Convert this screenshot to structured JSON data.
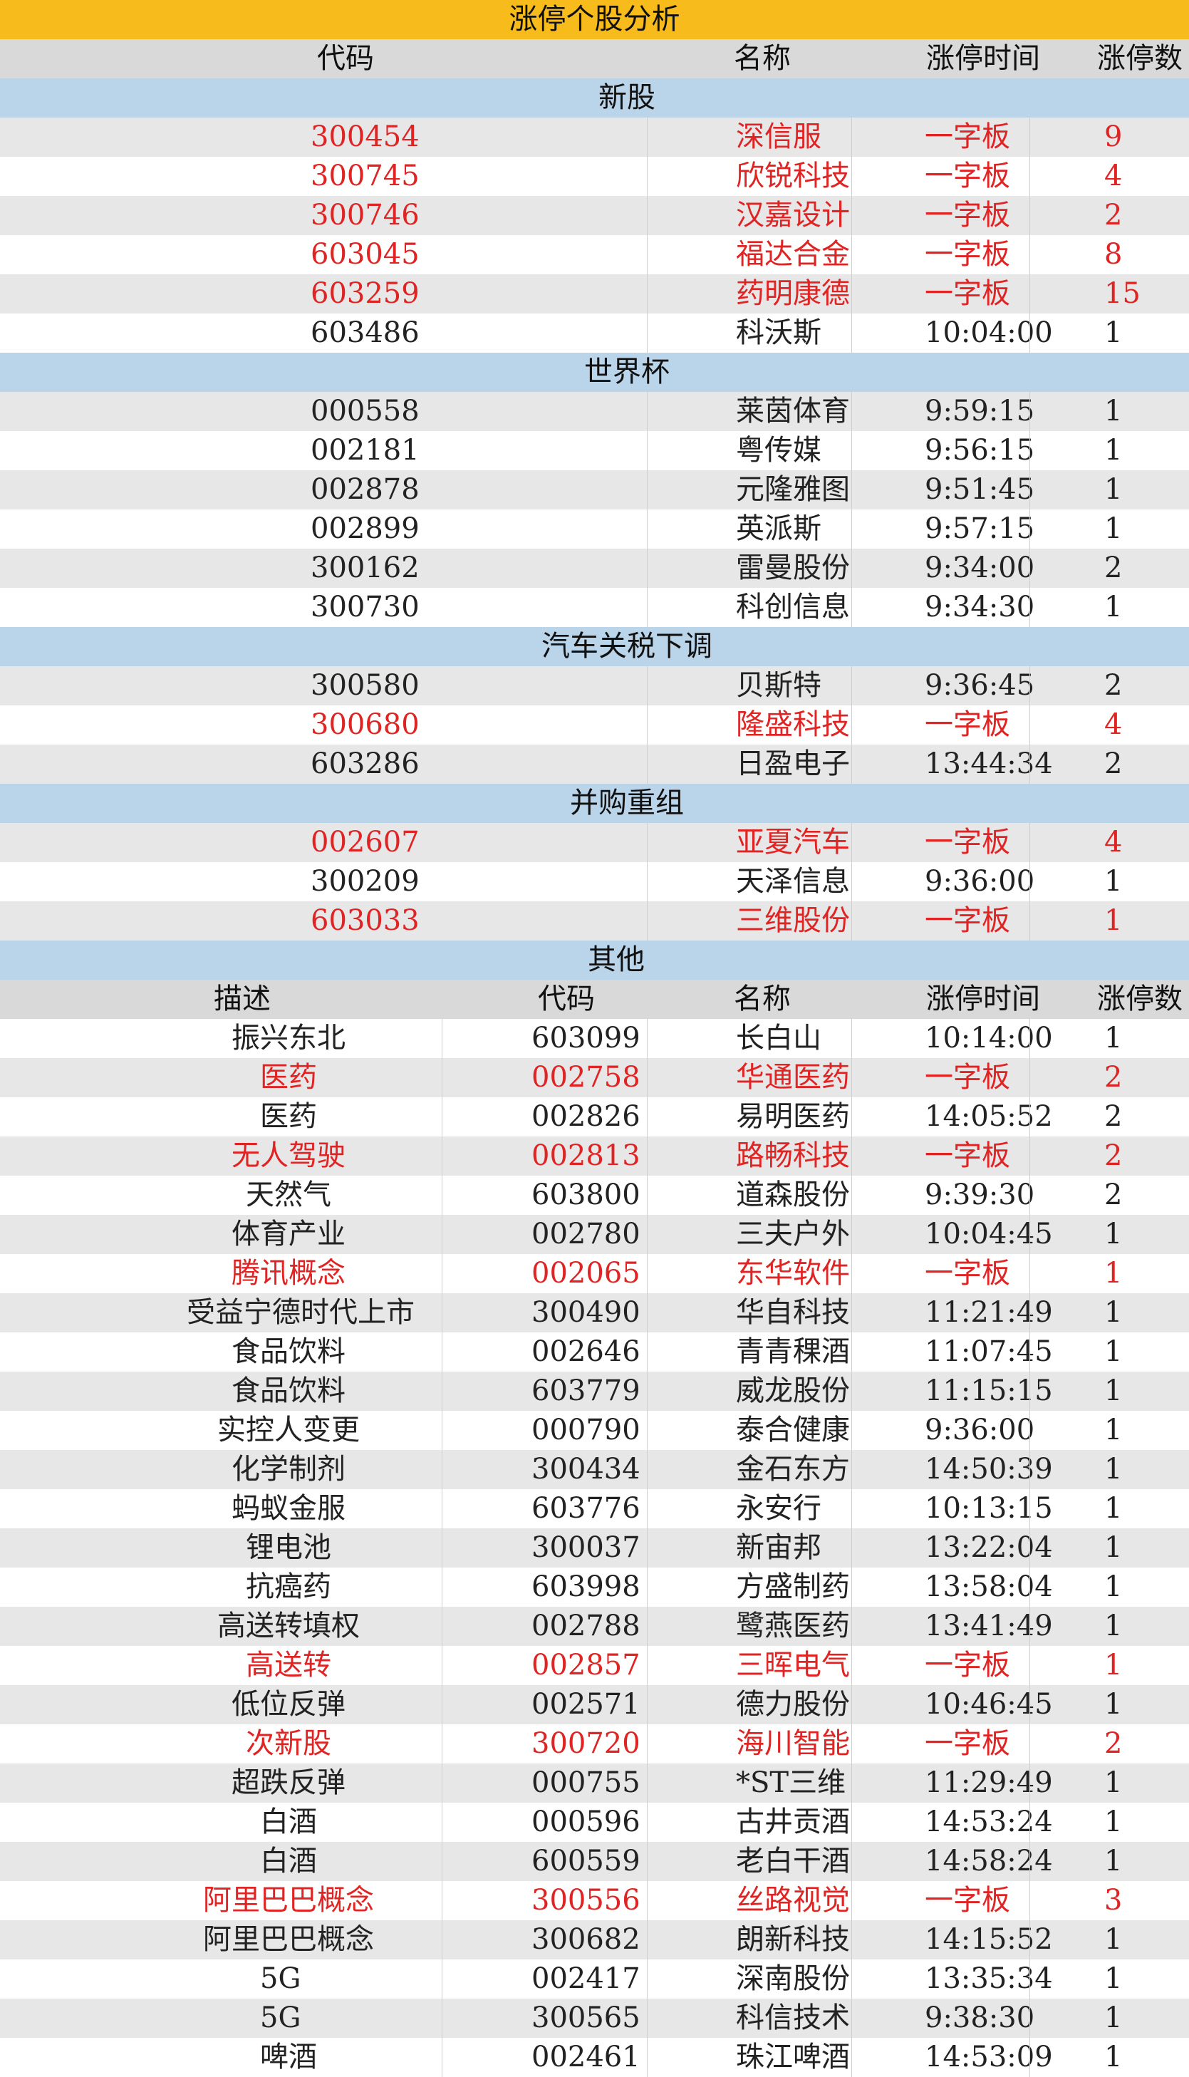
{
  "title": "涨停个股分析",
  "header1": {
    "code": "代码",
    "name": "名称",
    "time": "涨停时间",
    "count": "涨停数"
  },
  "header2": {
    "desc": "描述",
    "code": "代码",
    "name": "名称",
    "time": "涨停时间",
    "count": "涨停数"
  },
  "groups": [
    {
      "title": "新股",
      "rows": [
        {
          "code": "300454",
          "name": "深信服",
          "time": "一字板",
          "count": "9",
          "red": true
        },
        {
          "code": "300745",
          "name": "欣锐科技",
          "time": "一字板",
          "count": "4",
          "red": true
        },
        {
          "code": "300746",
          "name": "汉嘉设计",
          "time": "一字板",
          "count": "2",
          "red": true
        },
        {
          "code": "603045",
          "name": "福达合金",
          "time": "一字板",
          "count": "8",
          "red": true
        },
        {
          "code": "603259",
          "name": "药明康德",
          "time": "一字板",
          "count": "15",
          "red": true
        },
        {
          "code": "603486",
          "name": "科沃斯",
          "time": "10:04:00",
          "count": "1",
          "red": false
        }
      ]
    },
    {
      "title": "世界杯",
      "rows": [
        {
          "code": "000558",
          "name": "莱茵体育",
          "time": "9:59:15",
          "count": "1",
          "red": false
        },
        {
          "code": "002181",
          "name": "粤传媒",
          "time": "9:56:15",
          "count": "1",
          "red": false
        },
        {
          "code": "002878",
          "name": "元隆雅图",
          "time": "9:51:45",
          "count": "1",
          "red": false
        },
        {
          "code": "002899",
          "name": "英派斯",
          "time": "9:57:15",
          "count": "1",
          "red": false
        },
        {
          "code": "300162",
          "name": "雷曼股份",
          "time": "9:34:00",
          "count": "2",
          "red": false
        },
        {
          "code": "300730",
          "name": "科创信息",
          "time": "9:34:30",
          "count": "1",
          "red": false
        }
      ]
    },
    {
      "title": "汽车关税下调",
      "rows": [
        {
          "code": "300580",
          "name": "贝斯特",
          "time": "9:36:45",
          "count": "2",
          "red": false
        },
        {
          "code": "300680",
          "name": "隆盛科技",
          "time": "一字板",
          "count": "4",
          "red": true
        },
        {
          "code": "603286",
          "name": "日盈电子",
          "time": "13:44:34",
          "count": "2",
          "red": false
        }
      ]
    },
    {
      "title": "并购重组",
      "rows": [
        {
          "code": "002607",
          "name": "亚夏汽车",
          "time": "一字板",
          "count": "4",
          "red": true
        },
        {
          "code": "300209",
          "name": "天泽信息",
          "time": "9:36:00",
          "count": "1",
          "red": false
        },
        {
          "code": "603033",
          "name": "三维股份",
          "time": "一字板",
          "count": "1",
          "red": true
        }
      ]
    }
  ],
  "other": {
    "title": "其他",
    "rows": [
      {
        "desc": "振兴东北",
        "code": "603099",
        "name": "长白山",
        "time": "10:14:00",
        "count": "1",
        "red": false
      },
      {
        "desc": "医药",
        "code": "002758",
        "name": "华通医药",
        "time": "一字板",
        "count": "2",
        "red": true
      },
      {
        "desc": "医药",
        "code": "002826",
        "name": "易明医药",
        "time": "14:05:52",
        "count": "2",
        "red": false
      },
      {
        "desc": "无人驾驶",
        "code": "002813",
        "name": "路畅科技",
        "time": "一字板",
        "count": "2",
        "red": true
      },
      {
        "desc": "天然气",
        "code": "603800",
        "name": "道森股份",
        "time": "9:39:30",
        "count": "2",
        "red": false
      },
      {
        "desc": "体育产业",
        "code": "002780",
        "name": "三夫户外",
        "time": "10:04:45",
        "count": "1",
        "red": false
      },
      {
        "desc": "腾讯概念",
        "code": "002065",
        "name": "东华软件",
        "time": "一字板",
        "count": "1",
        "red": true
      },
      {
        "desc": "受益宁德时代上市",
        "code": "300490",
        "name": "华自科技",
        "time": "11:21:49",
        "count": "1",
        "red": false
      },
      {
        "desc": "食品饮料",
        "code": "002646",
        "name": "青青稞酒",
        "time": "11:07:45",
        "count": "1",
        "red": false
      },
      {
        "desc": "食品饮料",
        "code": "603779",
        "name": "威龙股份",
        "time": "11:15:15",
        "count": "1",
        "red": false
      },
      {
        "desc": "实控人变更",
        "code": "000790",
        "name": "泰合健康",
        "time": "9:36:00",
        "count": "1",
        "red": false
      },
      {
        "desc": "化学制剂",
        "code": "300434",
        "name": "金石东方",
        "time": "14:50:39",
        "count": "1",
        "red": false
      },
      {
        "desc": "蚂蚁金服",
        "code": "603776",
        "name": "永安行",
        "time": "10:13:15",
        "count": "1",
        "red": false
      },
      {
        "desc": "锂电池",
        "code": "300037",
        "name": "新宙邦",
        "time": "13:22:04",
        "count": "1",
        "red": false
      },
      {
        "desc": "抗癌药",
        "code": "603998",
        "name": "方盛制药",
        "time": "13:58:04",
        "count": "1",
        "red": false
      },
      {
        "desc": "高送转填权",
        "code": "002788",
        "name": "鹭燕医药",
        "time": "13:41:49",
        "count": "1",
        "red": false
      },
      {
        "desc": "高送转",
        "code": "002857",
        "name": "三晖电气",
        "time": "一字板",
        "count": "1",
        "red": true
      },
      {
        "desc": "低位反弹",
        "code": "002571",
        "name": "德力股份",
        "time": "10:46:45",
        "count": "1",
        "red": false
      },
      {
        "desc": "次新股",
        "code": "300720",
        "name": "海川智能",
        "time": "一字板",
        "count": "2",
        "red": true
      },
      {
        "desc": "超跌反弹",
        "code": "000755",
        "name": "*ST三维",
        "time": "11:29:49",
        "count": "1",
        "red": false
      },
      {
        "desc": "白酒",
        "code": "000596",
        "name": "古井贡酒",
        "time": "14:53:24",
        "count": "1",
        "red": false
      },
      {
        "desc": "白酒",
        "code": "600559",
        "name": "老白干酒",
        "time": "14:58:24",
        "count": "1",
        "red": false
      },
      {
        "desc": "阿里巴巴概念",
        "code": "300556",
        "name": "丝路视觉",
        "time": "一字板",
        "count": "3",
        "red": true
      },
      {
        "desc": "阿里巴巴概念",
        "code": "300682",
        "name": "朗新科技",
        "time": "14:15:52",
        "count": "1",
        "red": false
      },
      {
        "desc": "5G",
        "code": "002417",
        "name": "深南股份",
        "time": "13:35:34",
        "count": "1",
        "red": false
      },
      {
        "desc": "5G",
        "code": "300565",
        "name": "科信技术",
        "time": "9:38:30",
        "count": "1",
        "red": false
      },
      {
        "desc": "啤酒",
        "code": "002461",
        "name": "珠江啤酒",
        "time": "14:53:09",
        "count": "1",
        "red": false
      }
    ]
  }
}
